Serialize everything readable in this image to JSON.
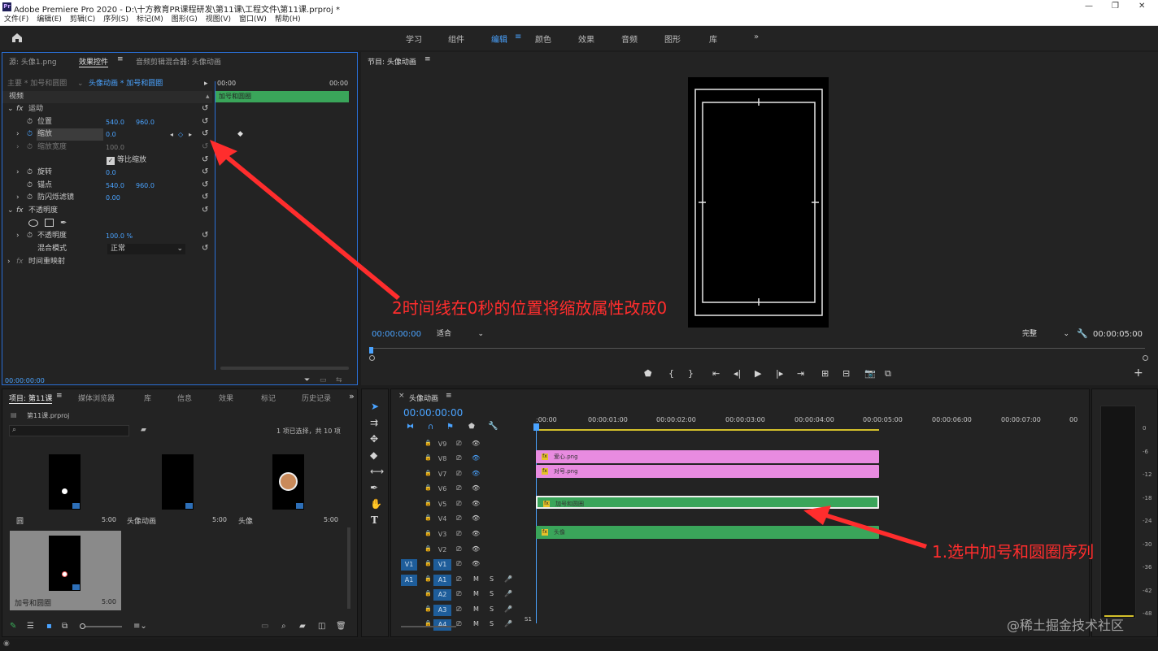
{
  "app": {
    "logo": "Pr",
    "title": "Adobe Premiere Pro 2020 - D:\\十方教育PR课程研发\\第11课\\工程文件\\第11课.prproj *"
  },
  "menu": [
    "文件(F)",
    "编辑(E)",
    "剪辑(C)",
    "序列(S)",
    "标记(M)",
    "图形(G)",
    "视图(V)",
    "窗口(W)",
    "帮助(H)"
  ],
  "workspaces": {
    "items": [
      "学习",
      "组件",
      "编辑",
      "颜色",
      "效果",
      "音频",
      "图形",
      "库"
    ],
    "active": "编辑",
    "more": "»"
  },
  "effect_controls": {
    "tabs": [
      "源: 头像1.png",
      "效果控件",
      "音频剪辑混合器: 头像动画"
    ],
    "active_tab": "效果控件",
    "master": "主要 * 加号和圆圈",
    "clip": "头像动画 * 加号和圆圈",
    "time_start": "00:00",
    "time_end": "00:00",
    "clip_bar_label": "加号和圆圈",
    "section_video": "视频",
    "motion": "运动",
    "position_label": "位置",
    "position_x": "540.0",
    "position_y": "960.0",
    "scale_label": "缩放",
    "scale_value": "0.0",
    "scale_width_label": "缩放宽度",
    "scale_width_value": "100.0",
    "uniform_scale_label": "等比缩放",
    "rotation_label": "旋转",
    "rotation_value": "0.0",
    "anchor_label": "锚点",
    "anchor_x": "540.0",
    "anchor_y": "960.0",
    "antiflicker_label": "防闪烁滤镜",
    "antiflicker_value": "0.00",
    "opacity_section": "不透明度",
    "opacity_label": "不透明度",
    "opacity_value": "100.0 %",
    "blend_label": "混合模式",
    "blend_value": "正常",
    "time_remap": "时间重映射",
    "timecode": "00:00:00:00"
  },
  "program": {
    "title": "节目: 头像动画",
    "timecode": "00:00:00:00",
    "fit": "适合",
    "quality": "完整",
    "duration": "00:00:05:00"
  },
  "project": {
    "tabs": [
      "项目: 第11课",
      "媒体浏览器",
      "库",
      "信息",
      "效果",
      "标记",
      "历史记录"
    ],
    "file": "第11课.prproj",
    "selection": "1 项已选择，共 10 项",
    "items": [
      {
        "name": "圆",
        "duration": "5:00"
      },
      {
        "name": "头像动画",
        "duration": "5:00"
      },
      {
        "name": "头像",
        "duration": "5:00"
      },
      {
        "name": "加号和圆圈",
        "duration": "5:00"
      }
    ]
  },
  "timeline": {
    "title": "头像动画",
    "timecode": "00:00:00:00",
    "ruler": [
      ":00:00",
      "00:00:01:00",
      "00:00:02:00",
      "00:00:03:00",
      "00:00:04:00",
      "00:00:05:00",
      "00:00:06:00",
      "00:00:07:00",
      "00"
    ],
    "video_tracks": [
      "V9",
      "V8",
      "V7",
      "V6",
      "V5",
      "V4",
      "V3",
      "V2",
      "V1"
    ],
    "audio_tracks": [
      "A1",
      "A2",
      "A3",
      "A4"
    ],
    "src_v": "V1",
    "src_a": "A1",
    "clips": [
      "爱心.png",
      "对号.png",
      "加号和圆圈",
      "头像"
    ],
    "mix": "S1"
  },
  "meters": [
    "0",
    "-6",
    "-12",
    "-18",
    "-24",
    "-30",
    "-36",
    "-42",
    "-48"
  ],
  "annotations": {
    "step2": "2时间线在0秒的位置将缩放属性改成0",
    "step1": "1.选中加号和圆圈序列"
  },
  "watermark": "@稀土掘金技术社区"
}
